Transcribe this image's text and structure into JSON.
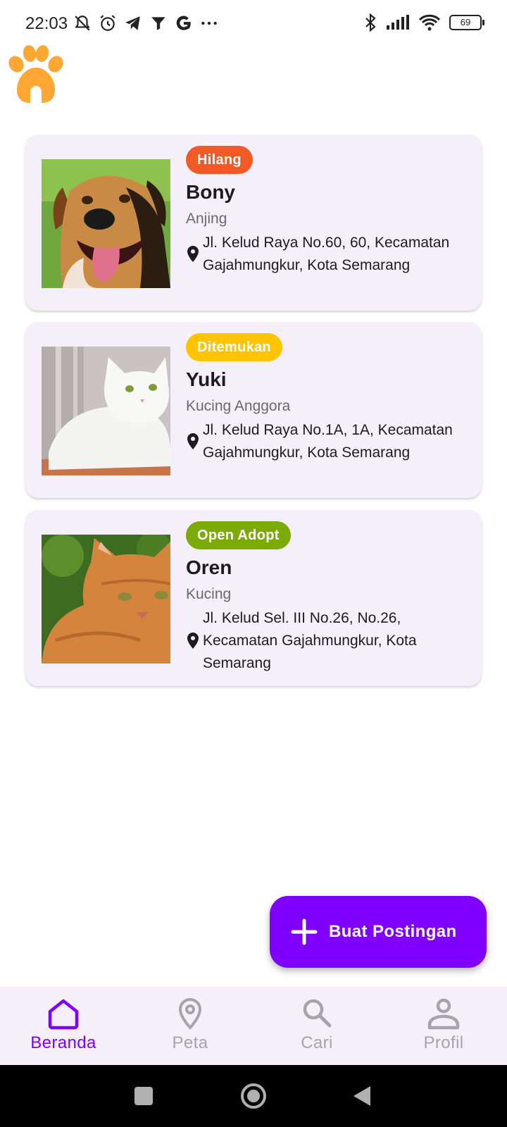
{
  "status_bar": {
    "time": "22:03",
    "battery": "69"
  },
  "app": {
    "logo_icon": "paw-home-icon",
    "accent_color": "#7f00ff"
  },
  "posts": [
    {
      "badge": "Hilang",
      "badge_color": "#f15a24",
      "name": "Bony",
      "type": "Anjing",
      "address": "Jl. Kelud Raya No.60, 60, Kecamatan Gajahmungkur, Kota Semarang"
    },
    {
      "badge": "Ditemukan",
      "badge_color": "#ffc400",
      "name": "Yuki",
      "type": "Kucing Anggora",
      "address": "Jl. Kelud Raya No.1A, 1A, Kecamatan Gajahmungkur, Kota Semarang"
    },
    {
      "badge": "Open Adopt",
      "badge_color": "#7cab08",
      "name": "Oren",
      "type": "Kucing",
      "address": "Jl. Kelud Sel. III No.26, No.26, Kecamatan Gajahmungkur, Kota Semarang"
    }
  ],
  "fab": {
    "label": "Buat Postingan",
    "icon": "plus-icon"
  },
  "bottom_nav": {
    "items": [
      {
        "label": "Beranda",
        "icon": "home-icon",
        "active": true
      },
      {
        "label": "Peta",
        "icon": "map-pin-icon",
        "active": false
      },
      {
        "label": "Cari",
        "icon": "search-icon",
        "active": false
      },
      {
        "label": "Profil",
        "icon": "person-icon",
        "active": false
      }
    ]
  }
}
